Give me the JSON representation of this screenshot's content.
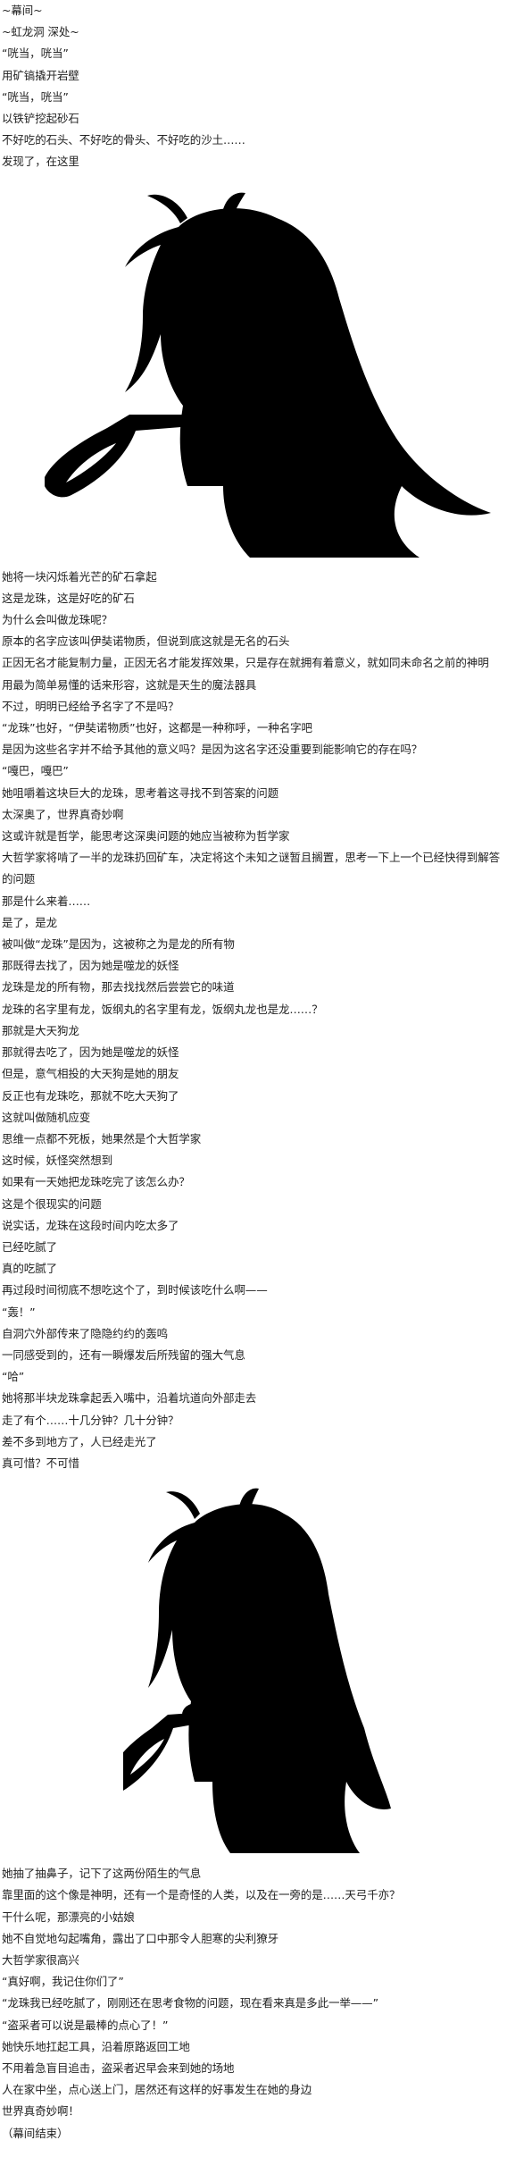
{
  "intro": [
    "~幕间~",
    "~虹龙洞 深处~",
    "“咣当，咣当”",
    "用矿镐撬开岩壁",
    "“咣当，咣当”",
    "以铁铲挖起砂石",
    "不好吃的石头、不好吃的骨头、不好吃的沙土……",
    "发现了，在这里"
  ],
  "silhouette_1_icon": "girl-with-shovel-silhouette",
  "middle": [
    "她将一块闪烁着光芒的矿石拿起",
    "这是龙珠，这是好吃的矿石",
    "为什么会叫做龙珠呢？",
    "原本的名字应该叫伊奘诺物质，但说到底这就是无名的石头",
    "正因无名才能复制力量，正因无名才能发挥效果，只是存在就拥有着意义，就如同未命名之前的神明",
    "用最为简单易懂的话来形容，这就是天生的魔法器具",
    "不过，明明已经给予名字了不是吗？",
    "“龙珠”也好，“伊奘诺物质”也好，这都是一种称呼，一种名字吧",
    "是因为这些名字并不给予其他的意义吗？是因为这名字还没重要到能影响它的存在吗？",
    "“嘎巴，嘎巴”",
    "她咀嚼着这块巨大的龙珠，思考着这寻找不到答案的问题",
    "太深奥了，世界真奇妙啊",
    "这或许就是哲学，能思考这深奥问题的她应当被称为哲学家",
    "大哲学家将啃了一半的龙珠扔回矿车，决定将这个未知之谜暂且搁置，思考一下上一个已经快得到解答的问题",
    "那是什么来着……",
    "是了，是龙",
    "被叫做“龙珠”是因为，这被称之为是龙的所有物",
    "那既得去找了，因为她是噬龙的妖怪",
    "龙珠是龙的所有物，那去找找然后尝尝它的味道",
    "龙珠的名字里有龙，饭纲丸的名字里有龙，饭纲丸龙也是龙……？",
    "那就是大天狗龙",
    "那就得去吃了，因为她是噬龙的妖怪",
    "但是，意气相投的大天狗是她的朋友",
    "反正也有龙珠吃，那就不吃大天狗了",
    "这就叫做随机应变",
    "思维一点都不死板，她果然是个大哲学家",
    "这时候，妖怪突然想到",
    "如果有一天她把龙珠吃完了该怎么办？",
    "这是个很现实的问题",
    "说实话，龙珠在这段时间内吃太多了",
    "已经吃腻了",
    "真的吃腻了",
    "再过段时间彻底不想吃这个了，到时候该吃什么啊——",
    "“轰！”",
    "自洞穴外部传来了隐隐约约的轰鸣",
    "一同感受到的，还有一瞬爆发后所残留的强大气息",
    "“哈”",
    "她将那半块龙珠拿起丢入嘴中，沿着坑道向外部走去",
    "走了有个……十几分钟？几十分钟？",
    "差不多到地方了，人已经走光了",
    "真可惜？不可惜"
  ],
  "silhouette_2_icon": "girl-with-shovel-silhouette",
  "ending": [
    "她抽了抽鼻子，记下了这两份陌生的气息",
    "靠里面的这个像是神明，还有一个是奇怪的人类，以及在一旁的是……天弓千亦？",
    "干什么呢，那漂亮的小姑娘",
    "她不自觉地勾起嘴角，露出了口中那令人胆寒的尖利獠牙",
    "大哲学家很高兴",
    "“真好啊，我记住你们了”",
    "“龙珠我已经吃腻了，刚刚还在思考食物的问题，现在看来真是多此一举——”",
    "“盗采者可以说是最棒的点心了！”",
    "她快乐地扛起工具，沿着原路返回工地",
    "不用着急盲目追击，盗采者迟早会来到她的场地",
    "人在家中坐，点心送上门，居然还有这样的好事发生在她的身边",
    "世界真奇妙啊！",
    "（幕间结束）"
  ]
}
